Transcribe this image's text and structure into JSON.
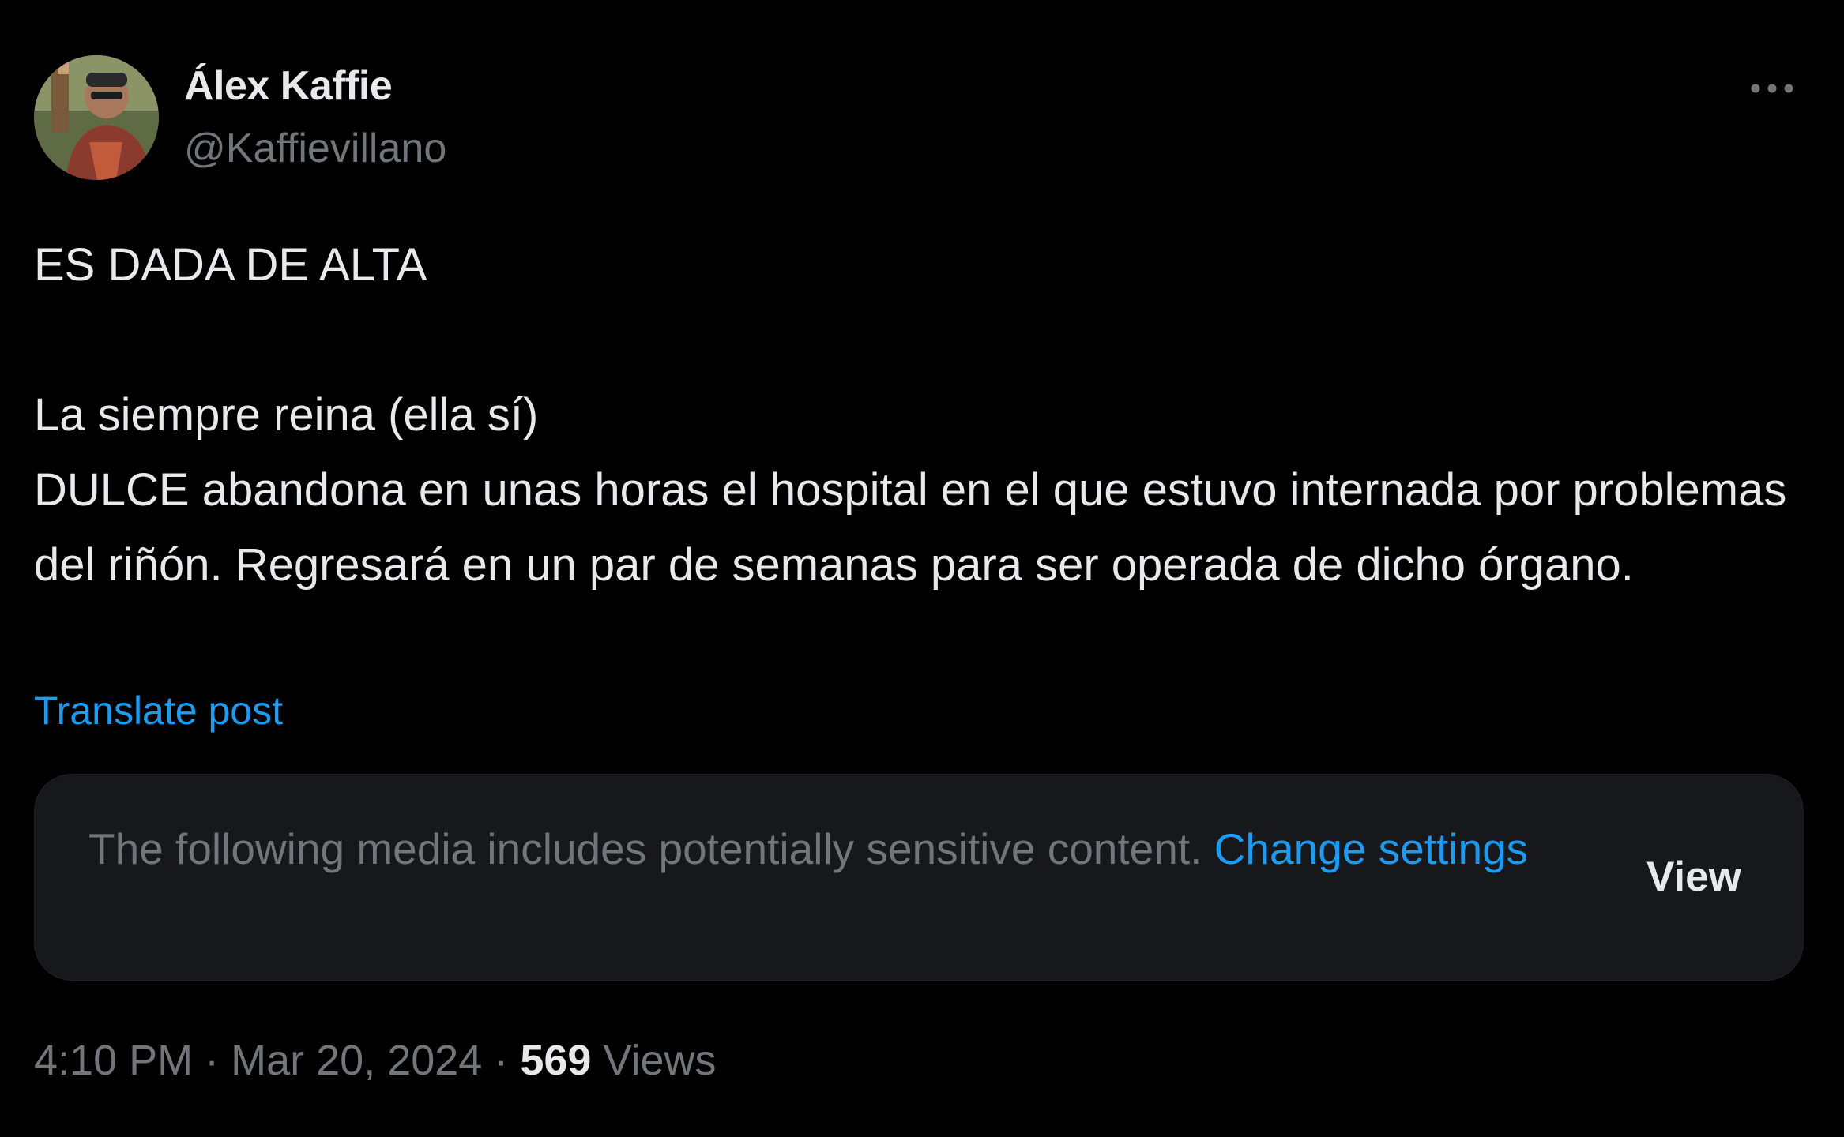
{
  "author": {
    "display_name": "Álex Kaffie",
    "handle": "@Kaffievillano",
    "avatar_icon": "user-avatar"
  },
  "more_icon": "more-horizontal-icon",
  "tweet": {
    "text": "ES DADA DE ALTA\n\nLa siempre reina (ella sí)\nDULCE abandona en unas horas el hospital en el que estuvo internada por problemas del riñón. Regresará en un par de semanas para ser operada de dicho órgano.",
    "translate_label": "Translate post"
  },
  "sensitive_media": {
    "warning_text": "The following media includes potentially sensitive content.",
    "link_label": "Change settings",
    "view_label": "View"
  },
  "meta": {
    "time": "4:10 PM",
    "separator": "·",
    "date": "Mar 20, 2024",
    "views_count": "569",
    "views_label": "Views"
  },
  "colors": {
    "background": "#000000",
    "text_primary": "#e7e9ea",
    "text_secondary": "#71767b",
    "accent": "#1d9bf0",
    "card_background": "#16181c"
  }
}
